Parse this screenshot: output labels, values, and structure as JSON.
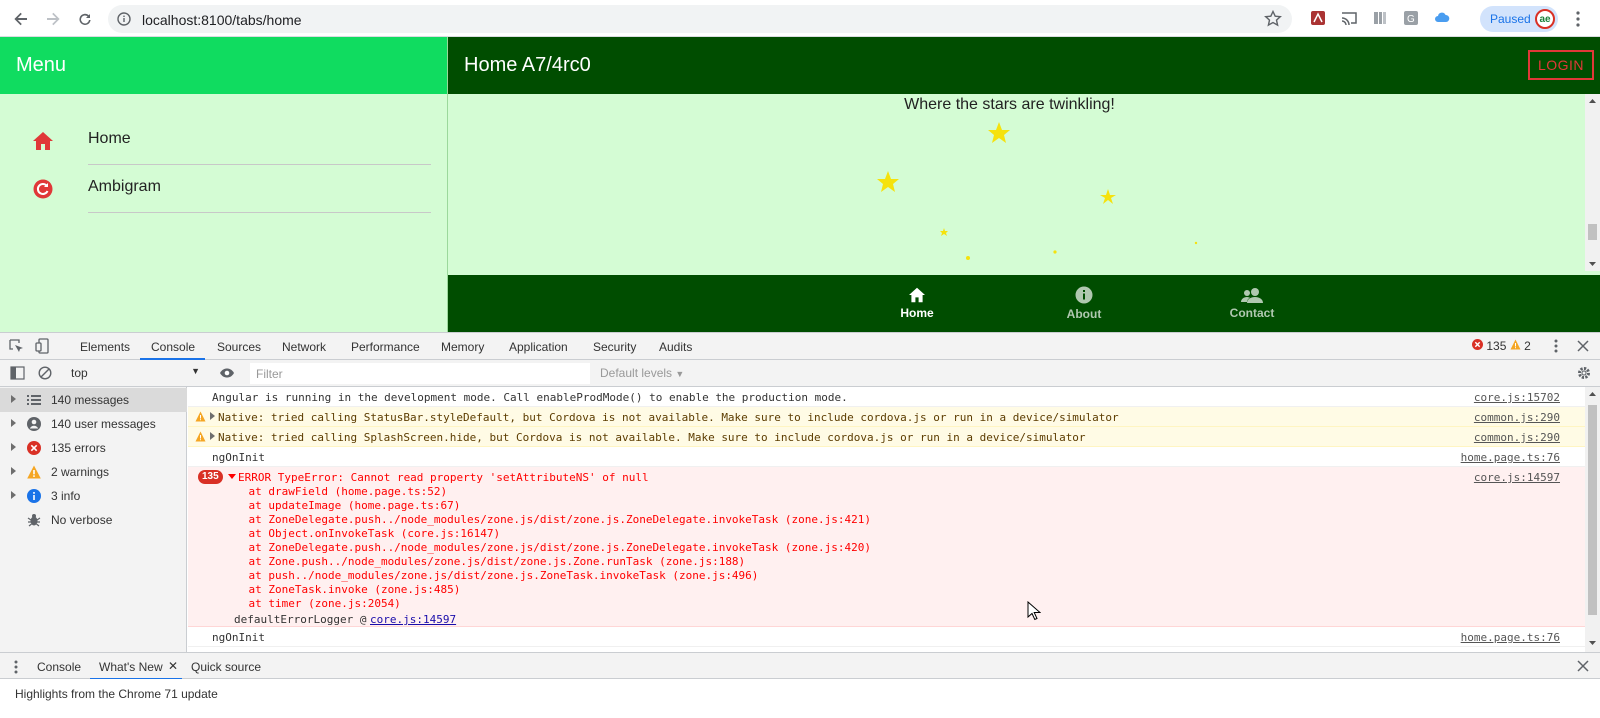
{
  "browser": {
    "url": "localhost:8100/tabs/home",
    "profile_label": "Paused"
  },
  "app": {
    "menu_title": "Menu",
    "menu_items": [
      {
        "label": "Home",
        "icon": "home-icon"
      },
      {
        "label": "Ambigram",
        "icon": "refresh-icon"
      }
    ],
    "page_title": "Home A7/4rc0",
    "login_label": "LOGIN",
    "tagline": "Where the stars are twinkling!",
    "tabs": [
      {
        "label": "Home",
        "icon": "home-icon",
        "active": true
      },
      {
        "label": "About",
        "icon": "info-icon",
        "active": false
      },
      {
        "label": "Contact",
        "icon": "people-icon",
        "active": false
      }
    ],
    "colors": {
      "menu_header": "#10dc60",
      "page_header": "#004d00",
      "background": "#d4fcd4",
      "star": "#f5e20d",
      "login": "#e03838"
    }
  },
  "devtools": {
    "tabs": [
      "Elements",
      "Console",
      "Sources",
      "Network",
      "Performance",
      "Memory",
      "Application",
      "Security",
      "Audits"
    ],
    "active_tab": "Console",
    "error_count": "135",
    "warning_count": "2",
    "context": "top",
    "filter_placeholder": "Filter",
    "levels": "Default levels",
    "sidebar": [
      {
        "label": "140 messages",
        "icon": "list-icon",
        "selected": true
      },
      {
        "label": "140 user messages",
        "icon": "user-icon",
        "selected": false
      },
      {
        "label": "135 errors",
        "icon": "error-icon",
        "selected": false
      },
      {
        "label": "2 warnings",
        "icon": "warning-icon",
        "selected": false
      },
      {
        "label": "3 info",
        "icon": "info-icon",
        "selected": false
      },
      {
        "label": "No verbose",
        "icon": "bug-icon",
        "selected": false
      }
    ],
    "messages": [
      {
        "type": "log",
        "text": "Angular is running in the development mode. Call enableProdMode() to enable the production mode.",
        "source": "core.js:15702"
      },
      {
        "type": "warn",
        "text": "Native: tried calling StatusBar.styleDefault, but Cordova is not available. Make sure to include cordova.js or run in a device/simulator",
        "source": "common.js:290"
      },
      {
        "type": "warn",
        "text": "Native: tried calling SplashScreen.hide, but Cordova is not available. Make sure to include cordova.js or run in a device/simulator",
        "source": "common.js:290"
      },
      {
        "type": "log",
        "text": "ngOnInit",
        "source": "home.page.ts:76"
      }
    ],
    "error": {
      "count": "135",
      "headline": "ERROR TypeError: Cannot read property 'setAttributeNS' of null",
      "source": "core.js:14597",
      "stack": [
        "    at drawField (home.page.ts:52)",
        "    at updateImage (home.page.ts:67)",
        "    at ZoneDelegate.push../node_modules/zone.js/dist/zone.js.ZoneDelegate.invokeTask (zone.js:421)",
        "    at Object.onInvokeTask (core.js:16147)",
        "    at ZoneDelegate.push../node_modules/zone.js/dist/zone.js.ZoneDelegate.invokeTask (zone.js:420)",
        "    at Zone.push../node_modules/zone.js/dist/zone.js.Zone.runTask (zone.js:188)",
        "    at push../node_modules/zone.js/dist/zone.js.ZoneTask.invokeTask (zone.js:496)",
        "    at ZoneTask.invoke (zone.js:485)",
        "    at timer (zone.js:2054)"
      ],
      "logger": "defaultErrorLogger @",
      "logger_link": "core.js:14597"
    },
    "last_message": {
      "text": "ngOnInit",
      "source": "home.page.ts:76"
    },
    "drawer_tabs": [
      "Console",
      "What's New",
      "Quick source"
    ],
    "active_drawer_tab": "What's New",
    "whats_new": "Highlights from the Chrome 71 update"
  }
}
